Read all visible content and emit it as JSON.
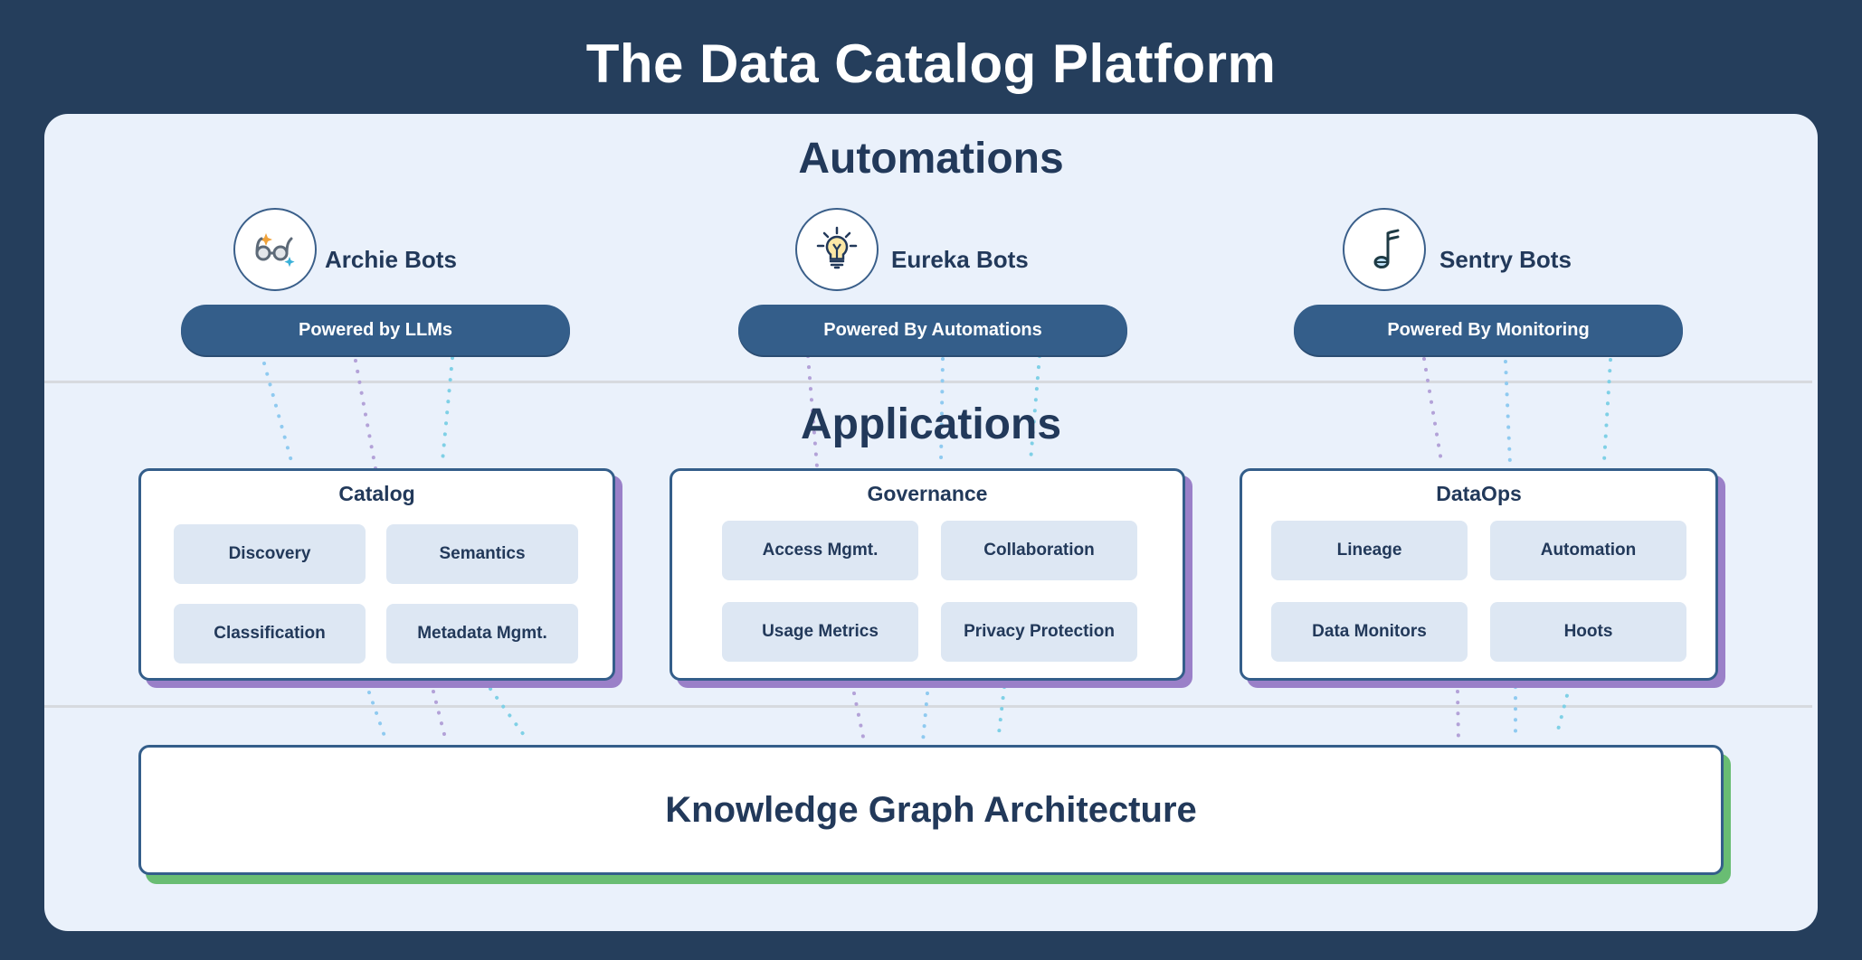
{
  "title": "The Data Catalog Platform",
  "sections": {
    "automations": "Automations",
    "applications": "Applications"
  },
  "bots": [
    {
      "name": "Archie Bots",
      "icon": "glasses-sparkle-icon",
      "pill": "Powered by LLMs"
    },
    {
      "name": "Eureka Bots",
      "icon": "lightbulb-icon",
      "pill": "Powered By Automations"
    },
    {
      "name": "Sentry Bots",
      "icon": "music-note-icon",
      "pill": "Powered By Monitoring"
    }
  ],
  "applications": [
    {
      "title": "Catalog",
      "features": [
        "Discovery",
        "Semantics",
        "Classification",
        "Metadata Mgmt."
      ]
    },
    {
      "title": "Governance",
      "features": [
        "Access Mgmt.",
        "Collaboration",
        "Usage Metrics",
        "Privacy Protection"
      ]
    },
    {
      "title": "DataOps",
      "features": [
        "Lineage",
        "Automation",
        "Data Monitors",
        "Hoots"
      ]
    }
  ],
  "foundation": {
    "title": "Knowledge Graph Architecture"
  },
  "colors": {
    "background": "#253e5c",
    "panel": "#eaf1fb",
    "primary": "#345e8a",
    "text": "#22395a",
    "feature_bg": "#dde7f3",
    "app_shadow": "#9a80c8",
    "foundation_shadow": "#69bd73",
    "connector_blue": "#8fcaf0",
    "connector_purple": "#b3a2d8",
    "connector_cyan": "#7fd0e6"
  }
}
